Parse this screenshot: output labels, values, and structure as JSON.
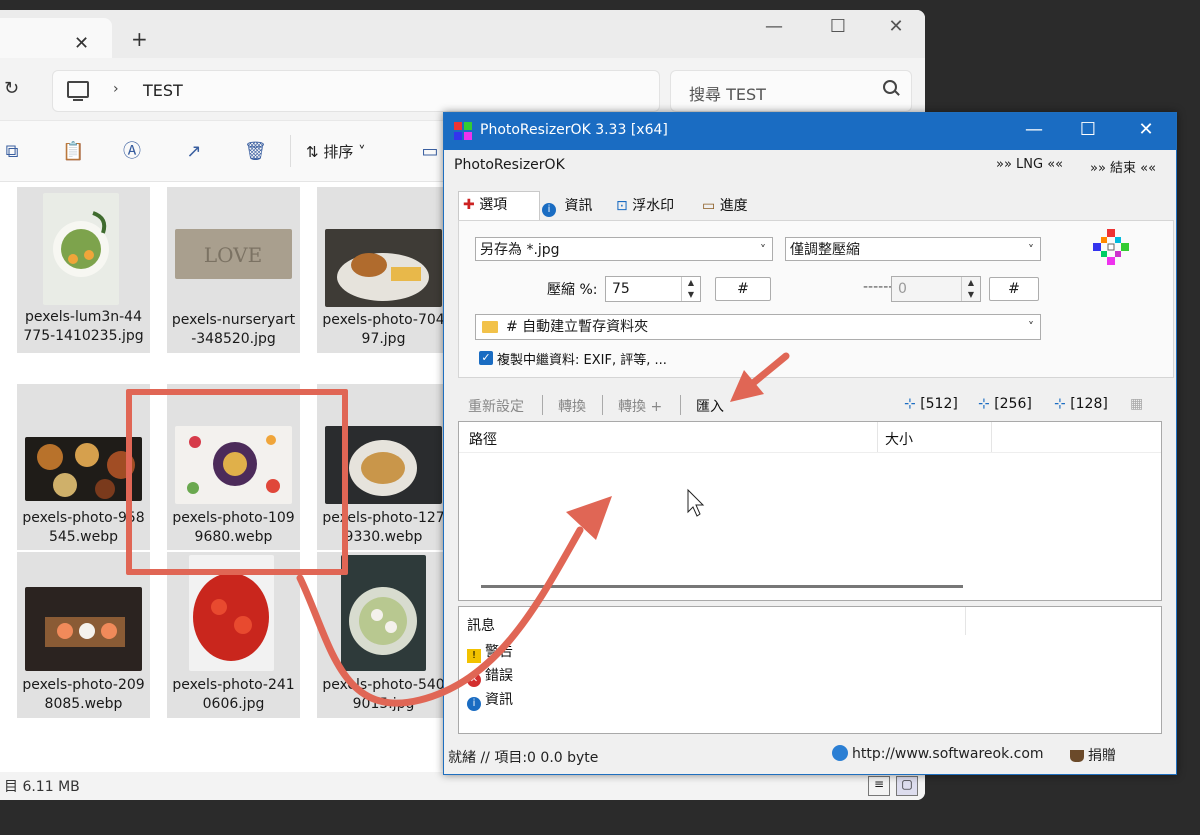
{
  "explorer": {
    "address_path": "TEST",
    "search_placeholder": "搜尋 TEST",
    "sort_label": "排序",
    "status_size": "目 6.11 MB",
    "files": [
      {
        "name": "pexels-lum3n-44775-1410235.jpg"
      },
      {
        "name": "pexels-nurseryart-348520.jpg"
      },
      {
        "name": "pexels-photo-70497.jpg"
      },
      {
        "name": "pexels-photo-958545.webp"
      },
      {
        "name": "pexels-photo-1099680.webp"
      },
      {
        "name": "pexels-photo-1279330.webp"
      },
      {
        "name": "pexels-photo-2098085.webp"
      },
      {
        "name": "pexels-photo-2410606.jpg"
      },
      {
        "name": "pexels-photo-5409015.jpg"
      }
    ]
  },
  "photoresizer": {
    "title": "PhotoResizerOK 3.33 [x64]",
    "app_label": "PhotoResizerOK",
    "menu_lng": "»» LNG ««",
    "menu_exit": "»» 結束 ««",
    "tabs": [
      {
        "label": "選項"
      },
      {
        "label": "資訊"
      },
      {
        "label": "浮水印"
      },
      {
        "label": "進度"
      }
    ],
    "save_as": "另存為 *.jpg",
    "mode": "僅調整壓縮",
    "compression_label": "壓縮 %:",
    "compression_value": "75",
    "hash_label": "#",
    "dash_label": "------",
    "second_value": "0",
    "folder": "# 自動建立暫存資料夾",
    "copy_meta": "複製中繼資料: EXIF, 評等, ...",
    "actions": {
      "reset": "重新設定",
      "convert": "轉換",
      "convert_plus": "轉換 +",
      "import": "匯入"
    },
    "sizes": [
      "[512]",
      "[256]",
      "[128]"
    ],
    "list_headers": {
      "path": "路徑",
      "size": "大小"
    },
    "messages": {
      "header": "訊息",
      "warning": "警告",
      "error": "錯誤",
      "info": "資訊"
    },
    "status": "就緒 // 項目:0 0.0 byte",
    "url": "http://www.softwareok.com",
    "donate": "捐贈"
  },
  "colors": {
    "title_bar": "#1a6cc2",
    "annotation": "#e06655"
  }
}
